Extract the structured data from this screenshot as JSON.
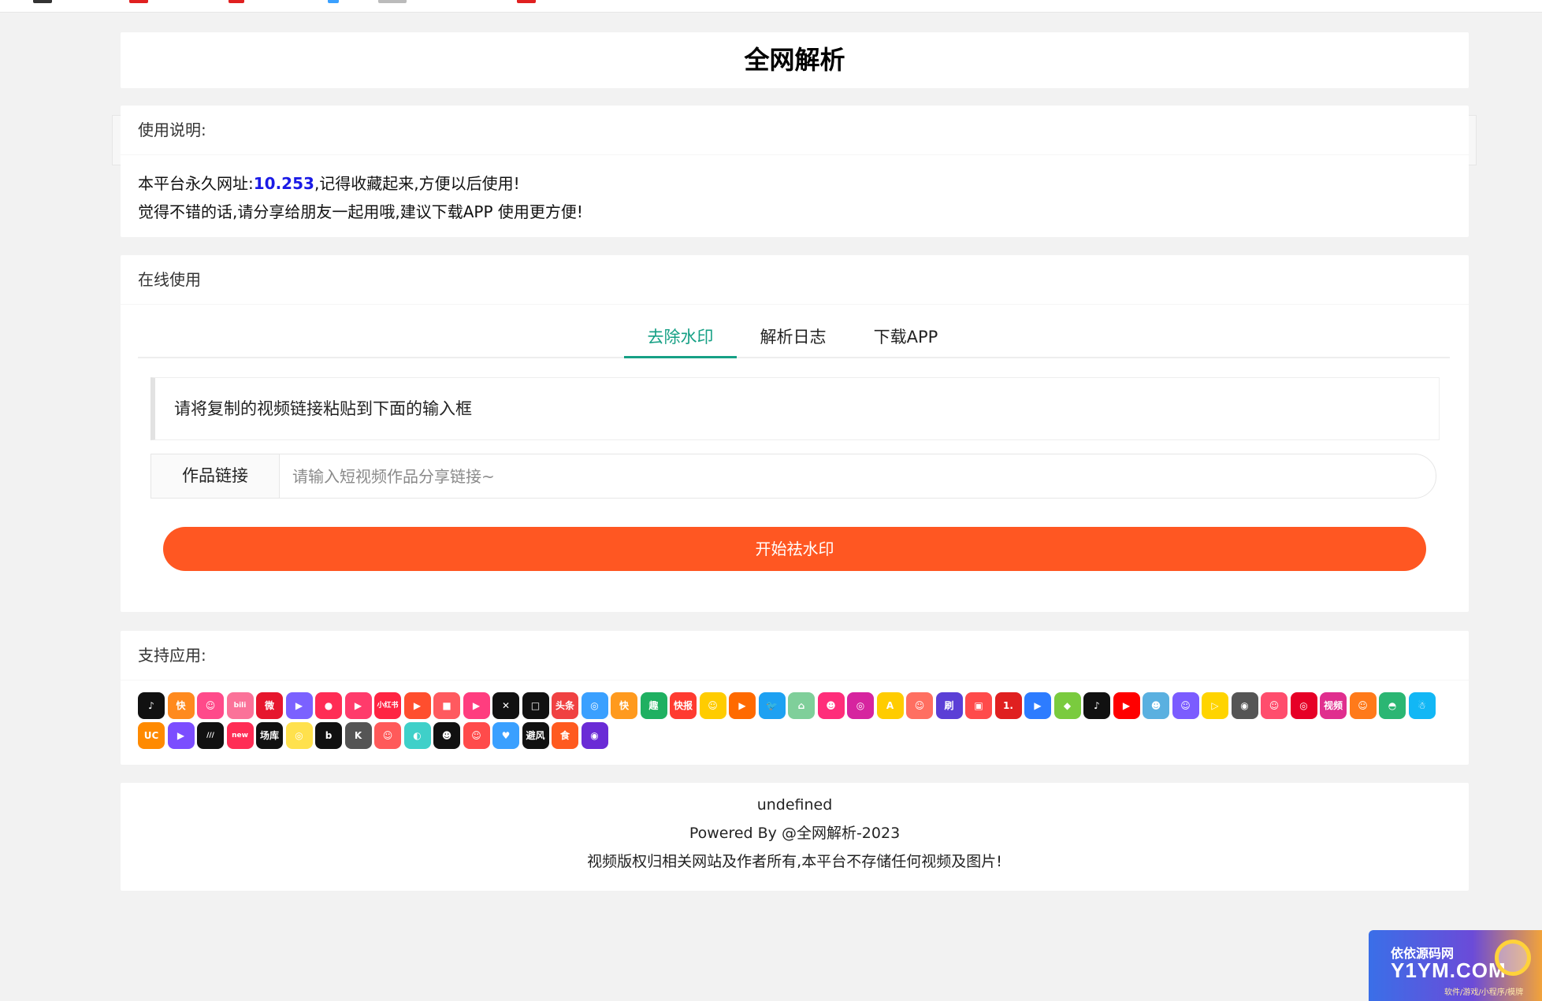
{
  "page": {
    "title": "全网解析"
  },
  "usage": {
    "header": "使用说明:",
    "line1_prefix": "本平台永久网址:",
    "line1_highlight": "10.253",
    "line1_suffix": ",记得收藏起来,方便以后使用!",
    "line2": "觉得不错的话,请分享给朋友一起用哦,建议下载APP 使用更方便!"
  },
  "online": {
    "header": "在线使用",
    "tabs": [
      {
        "label": "去除水印",
        "active": true
      },
      {
        "label": "解析日志",
        "active": false
      },
      {
        "label": "下载APP",
        "active": false
      }
    ],
    "notice": "请将复制的视频链接粘贴到下面的输入框",
    "input_label": "作品链接",
    "input_placeholder": "请输入短视频作品分享链接~",
    "input_value": "",
    "button_label": "开始祛水印"
  },
  "support": {
    "header": "支持应用:",
    "apps": [
      {
        "name": "douyin-icon",
        "color": "#111111",
        "glyph": "♪"
      },
      {
        "name": "kuaishou-icon",
        "color": "#ff8a1e",
        "glyph": "快"
      },
      {
        "name": "app3-icon",
        "color": "#ff4a8a",
        "glyph": "☺"
      },
      {
        "name": "bilibili-icon",
        "color": "#fb7299",
        "glyph": "bili"
      },
      {
        "name": "weibo-icon",
        "color": "#e6162d",
        "glyph": "微"
      },
      {
        "name": "app6-icon",
        "color": "#7b61ff",
        "glyph": "▶"
      },
      {
        "name": "app7-icon",
        "color": "#ff2d55",
        "glyph": "●"
      },
      {
        "name": "app8-icon",
        "color": "#ff3b6b",
        "glyph": "▶"
      },
      {
        "name": "xiaohongshu-icon",
        "color": "#ff2442",
        "glyph": "小红书"
      },
      {
        "name": "app10-icon",
        "color": "#ff4e2e",
        "glyph": "▶"
      },
      {
        "name": "app11-icon",
        "color": "#ff5a5f",
        "glyph": "■"
      },
      {
        "name": "app12-icon",
        "color": "#ff3d7f",
        "glyph": "▶"
      },
      {
        "name": "capcut-icon",
        "color": "#111111",
        "glyph": "✕"
      },
      {
        "name": "app14-icon",
        "color": "#111111",
        "glyph": "□"
      },
      {
        "name": "toutiao-icon",
        "color": "#f04142",
        "glyph": "头条"
      },
      {
        "name": "app16-icon",
        "color": "#3aa0ff",
        "glyph": "◎"
      },
      {
        "name": "kuai-icon",
        "color": "#ff9a1e",
        "glyph": "快"
      },
      {
        "name": "qu-icon",
        "color": "#1fb061",
        "glyph": "趣"
      },
      {
        "name": "kuaibao-icon",
        "color": "#ff3b30",
        "glyph": "快报"
      },
      {
        "name": "app20-icon",
        "color": "#ffcc00",
        "glyph": "☺"
      },
      {
        "name": "app21-icon",
        "color": "#ff6a00",
        "glyph": "▶"
      },
      {
        "name": "twitter-icon",
        "color": "#1da1f2",
        "glyph": "🐦"
      },
      {
        "name": "app23-icon",
        "color": "#7fcf9a",
        "glyph": "⌂"
      },
      {
        "name": "app24-icon",
        "color": "#ff2d7a",
        "glyph": "☻"
      },
      {
        "name": "instagram-icon",
        "color": "#d6249f",
        "glyph": "◎"
      },
      {
        "name": "app26-icon",
        "color": "#ffcc00",
        "glyph": "A"
      },
      {
        "name": "app27-icon",
        "color": "#ff6f61",
        "glyph": "☺"
      },
      {
        "name": "gang-icon",
        "color": "#5b3fd6",
        "glyph": "刷"
      },
      {
        "name": "app29-icon",
        "color": "#ff4b4b",
        "glyph": "▣"
      },
      {
        "name": "app30-icon",
        "color": "#e02020",
        "glyph": "1."
      },
      {
        "name": "app31-icon",
        "color": "#2d7cff",
        "glyph": "▶"
      },
      {
        "name": "app32-icon",
        "color": "#7acb3e",
        "glyph": "◆"
      },
      {
        "name": "tiktok-icon",
        "color": "#111111",
        "glyph": "♪"
      },
      {
        "name": "youtube-icon",
        "color": "#ff0000",
        "glyph": "▶"
      },
      {
        "name": "app35-icon",
        "color": "#5ab0e0",
        "glyph": "☻"
      },
      {
        "name": "app36-icon",
        "color": "#7b5cff",
        "glyph": "☺"
      },
      {
        "name": "app37-icon",
        "color": "#ffd400",
        "glyph": "▷"
      },
      {
        "name": "app38-icon",
        "color": "#555555",
        "glyph": "◉"
      },
      {
        "name": "app39-icon",
        "color": "#ff4d6d",
        "glyph": "☺"
      },
      {
        "name": "netease-icon",
        "color": "#e60026",
        "glyph": "◎"
      },
      {
        "name": "shipin-icon",
        "color": "#e02e8e",
        "glyph": "视频"
      },
      {
        "name": "app42-icon",
        "color": "#ff7a1a",
        "glyph": "☺"
      },
      {
        "name": "app43-icon",
        "color": "#2bb673",
        "glyph": "◓"
      },
      {
        "name": "qq-icon",
        "color": "#12b7f5",
        "glyph": "☃"
      },
      {
        "name": "uc-icon",
        "color": "#ff8a00",
        "glyph": "UC"
      },
      {
        "name": "app46-icon",
        "color": "#7b4dff",
        "glyph": "▶"
      },
      {
        "name": "app47-icon",
        "color": "#111111",
        "glyph": "/// "
      },
      {
        "name": "new-icon",
        "color": "#ff2d55",
        "glyph": "new"
      },
      {
        "name": "changku-icon",
        "color": "#111111",
        "glyph": "场库"
      },
      {
        "name": "app50-icon",
        "color": "#ffe14d",
        "glyph": "◎"
      },
      {
        "name": "app51-icon",
        "color": "#111111",
        "glyph": "b"
      },
      {
        "name": "k-icon",
        "color": "#555555",
        "glyph": "K"
      },
      {
        "name": "app53-icon",
        "color": "#ff5a5a",
        "glyph": "☺"
      },
      {
        "name": "app54-icon",
        "color": "#3fd0c9",
        "glyph": "◐"
      },
      {
        "name": "app55-icon",
        "color": "#111111",
        "glyph": "☻"
      },
      {
        "name": "app56-icon",
        "color": "#ff4b4b",
        "glyph": "☺"
      },
      {
        "name": "app57-icon",
        "color": "#3aa0ff",
        "glyph": "♥"
      },
      {
        "name": "bifeng-icon",
        "color": "#111111",
        "glyph": "避风"
      },
      {
        "name": "shi-icon",
        "color": "#ff5a1f",
        "glyph": "食"
      },
      {
        "name": "app60-icon",
        "color": "#6a2bd6",
        "glyph": "◉"
      }
    ]
  },
  "footer": {
    "line1": "undefined",
    "line2": "Powered By @全网解析-2023",
    "line3": "视频版权归相关网站及作者所有,本平台不存储任何视频及图片!"
  },
  "badge": {
    "line1": "依依源码网",
    "line2": "Y1YM.COM",
    "line3": "软件/游戏/小程序/模牌"
  }
}
